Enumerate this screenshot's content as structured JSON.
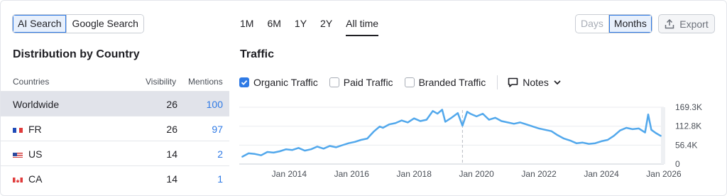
{
  "search_toggle": {
    "options": [
      "AI Search",
      "Google Search"
    ],
    "selected": "AI Search"
  },
  "periods": {
    "options": [
      "1M",
      "6M",
      "1Y",
      "2Y",
      "All time"
    ],
    "selected": "All time"
  },
  "granularity": {
    "options": [
      "Days",
      "Months"
    ],
    "selected": "Months",
    "disabled": "Days"
  },
  "export_label": "Export",
  "distribution": {
    "title": "Distribution by Country",
    "headers": {
      "country": "Countries",
      "visibility": "Visibility",
      "mentions": "Mentions"
    },
    "rows": [
      {
        "country": "Worldwide",
        "flag": "",
        "visibility": "26",
        "mentions": "100"
      },
      {
        "country": "FR",
        "flag": "fr",
        "visibility": "26",
        "mentions": "97"
      },
      {
        "country": "US",
        "flag": "us",
        "visibility": "14",
        "mentions": "2"
      },
      {
        "country": "CA",
        "flag": "ca",
        "visibility": "14",
        "mentions": "1"
      }
    ]
  },
  "traffic": {
    "title": "Traffic",
    "legend": [
      {
        "label": "Organic Traffic",
        "checked": true
      },
      {
        "label": "Paid Traffic",
        "checked": false
      },
      {
        "label": "Branded Traffic",
        "checked": false
      }
    ],
    "notes_label": "Notes"
  },
  "chart_data": {
    "type": "line",
    "series": [
      {
        "name": "Organic Traffic",
        "color": "#52a8ec",
        "x": [
          2012.5,
          2012.7,
          2012.9,
          2013.1,
          2013.3,
          2013.5,
          2013.7,
          2013.9,
          2014.1,
          2014.3,
          2014.5,
          2014.7,
          2014.9,
          2015.1,
          2015.3,
          2015.5,
          2015.7,
          2015.9,
          2016.1,
          2016.3,
          2016.5,
          2016.7,
          2016.9,
          2017.0,
          2017.2,
          2017.4,
          2017.6,
          2017.8,
          2018.0,
          2018.2,
          2018.4,
          2018.6,
          2018.75,
          2018.9,
          2019.0,
          2019.2,
          2019.4,
          2019.55,
          2019.7,
          2019.8,
          2020.0,
          2020.2,
          2020.4,
          2020.6,
          2020.8,
          2021.0,
          2021.2,
          2021.4,
          2021.6,
          2021.8,
          2022.0,
          2022.2,
          2022.4,
          2022.6,
          2022.8,
          2023.0,
          2023.2,
          2023.4,
          2023.6,
          2023.8,
          2024.0,
          2024.2,
          2024.4,
          2024.6,
          2024.8,
          2025.0,
          2025.2,
          2025.4,
          2025.5,
          2025.6,
          2025.75,
          2025.9
        ],
        "y": [
          22,
          32,
          30,
          26,
          36,
          34,
          38,
          44,
          42,
          48,
          40,
          44,
          52,
          46,
          54,
          50,
          56,
          62,
          66,
          72,
          76,
          96,
          112,
          108,
          118,
          122,
          130,
          124,
          136,
          128,
          132,
          158,
          150,
          162,
          126,
          138,
          152,
          114,
          156,
          150,
          142,
          150,
          132,
          138,
          128,
          124,
          120,
          124,
          118,
          112,
          106,
          102,
          98,
          86,
          76,
          70,
          62,
          64,
          60,
          62,
          68,
          72,
          84,
          100,
          108,
          104,
          106,
          94,
          148,
          102,
          92,
          84
        ]
      }
    ],
    "x_ticks": [
      "Jan 2014",
      "Jan 2016",
      "Jan 2018",
      "Jan 2020",
      "Jan 2022",
      "Jan 2024",
      "Jan 2026"
    ],
    "x_tick_values": [
      2014,
      2016,
      2018,
      2020,
      2022,
      2024,
      2026
    ],
    "y_ticks": [
      "0",
      "56.4K",
      "112.8K",
      "169.3K"
    ],
    "y_tick_values": [
      0,
      56.4,
      112.8,
      169.3
    ],
    "xlim": [
      2012.4,
      2026.0
    ],
    "ylim": [
      0,
      169.3
    ],
    "unit": "K",
    "note_marker_x": 2019.55,
    "grid": true
  }
}
